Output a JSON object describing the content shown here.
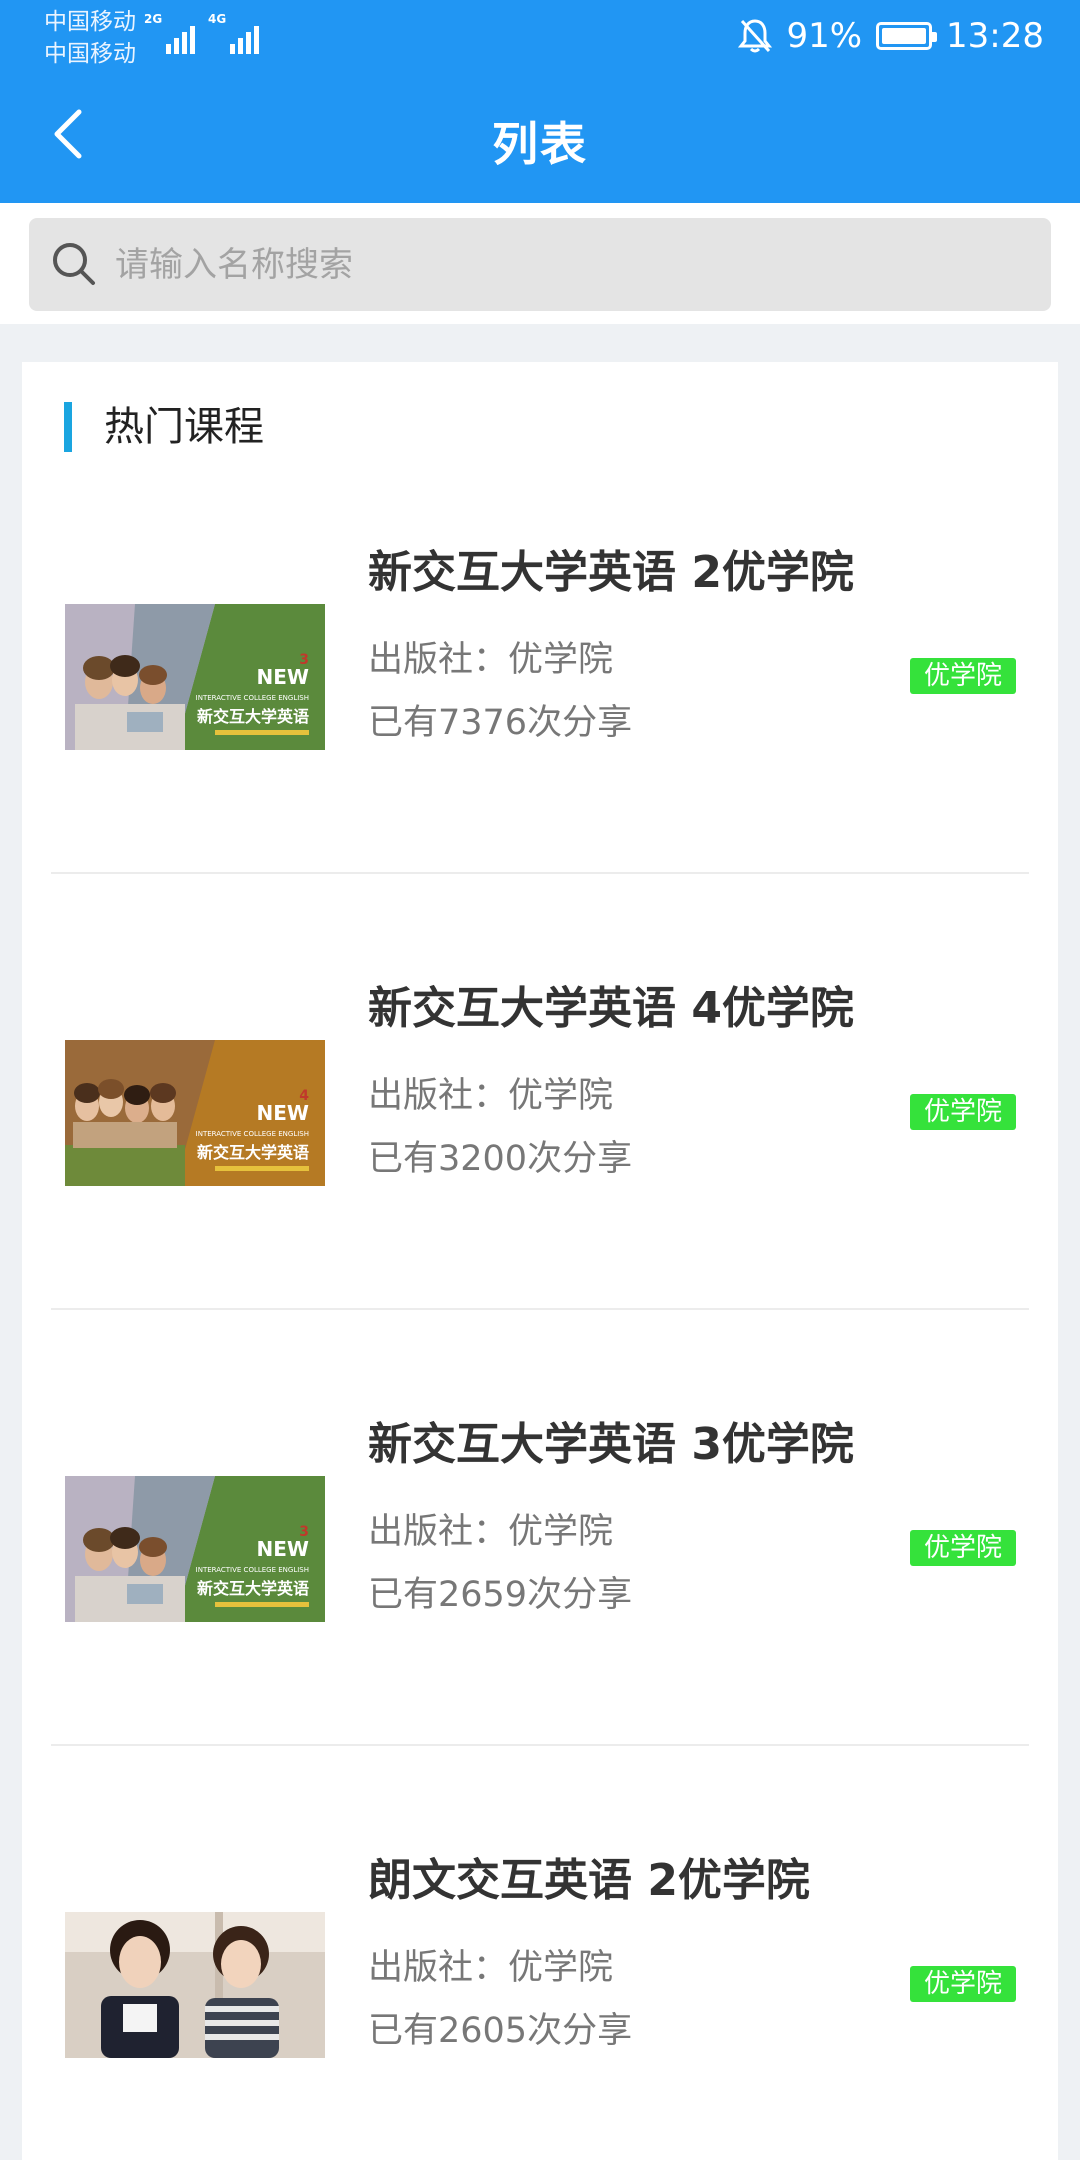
{
  "status_bar": {
    "carrier_1": "中国移动",
    "carrier_2": "中国移动",
    "signal_1_label": "2G",
    "signal_2_label": "4G",
    "battery": "91%",
    "time": "13:28",
    "icons": [
      "bell-off-icon",
      "battery-icon"
    ]
  },
  "header": {
    "title": "列表",
    "back_icon": "chevron-left-icon"
  },
  "search": {
    "placeholder": "请输入名称搜索",
    "value": "",
    "icon": "search-icon"
  },
  "section": {
    "title": "热门课程",
    "accent_color": "#1aa5e0"
  },
  "colors": {
    "brand": "#2196f3",
    "tag": "#35e23b"
  },
  "courses": [
    {
      "title": "新交互大学英语 2优学院",
      "publisher": "出版社：优学院",
      "shares": "已有7376次分享",
      "tag": "优学院",
      "cover_title": "新交互大学英语",
      "cover_number": "3",
      "cover_brand": "NEW",
      "cover_sub": "INTERACTIVE COLLEGE ENGLISH"
    },
    {
      "title": "新交互大学英语 4优学院",
      "publisher": "出版社：优学院",
      "shares": "已有3200次分享",
      "tag": "优学院",
      "cover_title": "新交互大学英语",
      "cover_number": "4",
      "cover_brand": "NEW",
      "cover_sub": "INTERACTIVE COLLEGE ENGLISH"
    },
    {
      "title": "新交互大学英语 3优学院",
      "publisher": "出版社：优学院",
      "shares": "已有2659次分享",
      "tag": "优学院",
      "cover_title": "新交互大学英语",
      "cover_number": "3",
      "cover_brand": "NEW",
      "cover_sub": "INTERACTIVE COLLEGE ENGLISH"
    },
    {
      "title": "朗文交互英语 2优学院",
      "publisher": "出版社：优学院",
      "shares": "已有2605次分享",
      "tag": "优学院"
    }
  ]
}
